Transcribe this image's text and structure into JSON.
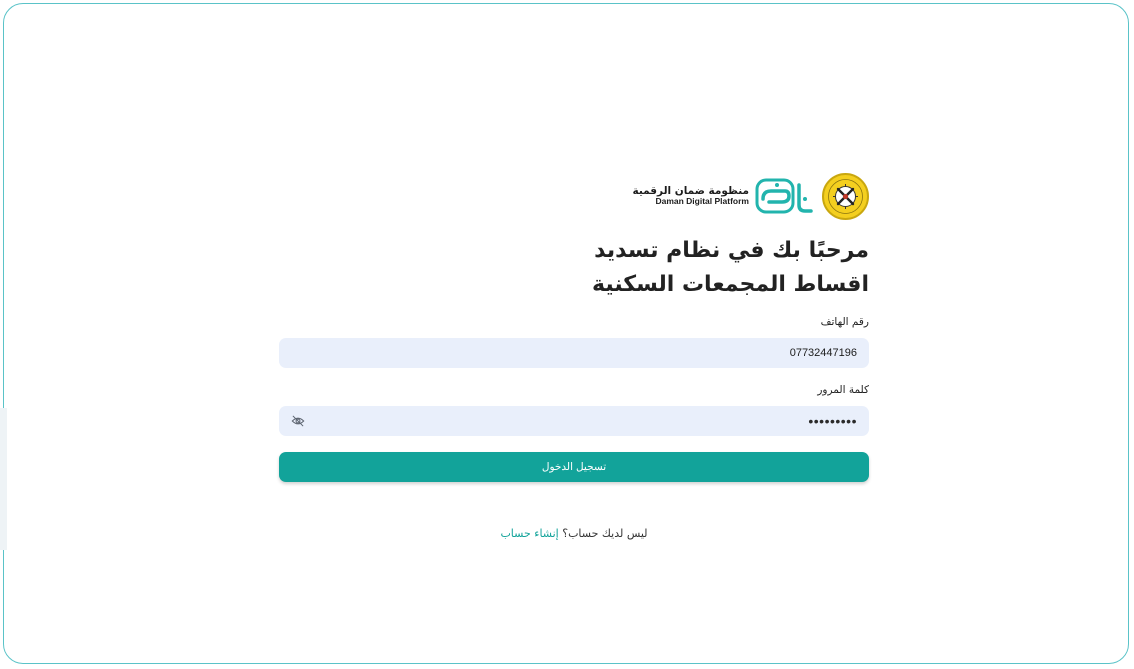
{
  "brand": {
    "name_ar": "منظومة ضمان الرقمية",
    "name_en": "Daman Digital Platform",
    "logo_text": "ضمان",
    "accent_color": "#12a39a"
  },
  "heading": "مرحبًا بك في نظام تسديد اقساط المجمعات السكنية",
  "form": {
    "phone_label": "رقم الهاتف",
    "phone_value": "07732447196",
    "password_label": "كلمة المرور",
    "password_mask": "•••••••••",
    "password_toggle_icon": "eye-off-icon",
    "login_label": "تسجيل الدخول"
  },
  "signup": {
    "prompt": "ليس لديك حساب؟",
    "link": "إنشاء حساب"
  }
}
